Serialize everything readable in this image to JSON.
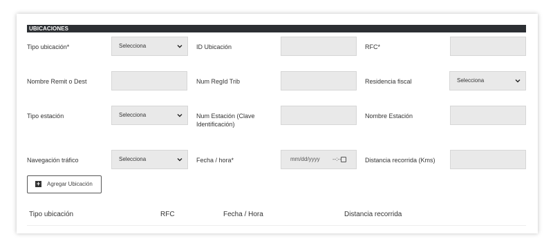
{
  "section": {
    "title": "UBICACIONES"
  },
  "fields": {
    "tipo_ubicacion": {
      "label": "Tipo ubicación*",
      "value": "Selecciona"
    },
    "id_ubicacion": {
      "label": "ID Ubicación"
    },
    "rfc": {
      "label": "RFC*"
    },
    "nombre_remitente": {
      "label": "Nombre Remit o Dest"
    },
    "num_reg_id_trib": {
      "label": "Num RegId Trib"
    },
    "residencia_fiscal": {
      "label": "Residencia fiscal",
      "value": "Selecciona"
    },
    "tipo_estacion": {
      "label": "Tipo estación",
      "value": "Selecciona"
    },
    "num_estacion": {
      "label": "Num Estación (Clave Identificación)"
    },
    "nombre_estacion": {
      "label": "Nombre Estación"
    },
    "navegacion_trafico": {
      "label": "Navegación tráfico",
      "value": "Selecciona"
    },
    "fecha_hora": {
      "label": "Fecha / hora*",
      "placeholder": "mm/dd/yyyy",
      "time_sep": "--:--"
    },
    "distancia_recorrida": {
      "label": "Distancia recorrida (Kms)"
    }
  },
  "add_button": {
    "label": "Agregar Ubicación",
    "icon": "plus-square-icon"
  },
  "table": {
    "headers": [
      "Tipo ubicación",
      "RFC",
      "Fecha / Hora",
      "Distancia recorrida"
    ]
  }
}
